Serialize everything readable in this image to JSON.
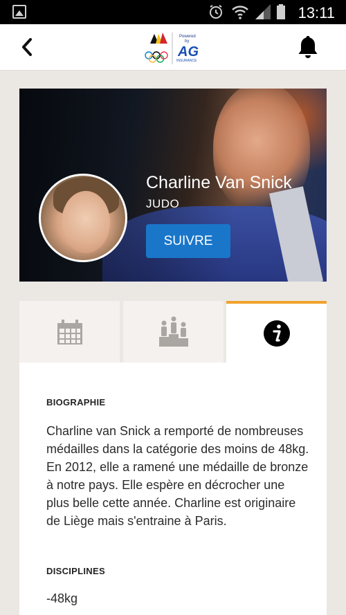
{
  "status_bar": {
    "time": "13:11",
    "icons": [
      "gallery-icon",
      "alarm-icon",
      "wifi-icon",
      "signal-icon",
      "battery-icon"
    ]
  },
  "header": {
    "back_icon": "chevron-left-icon",
    "logo_text": "Powered by AG INSURANCE",
    "notification_icon": "bell-icon"
  },
  "athlete": {
    "name": "Charline Van Snick",
    "sport": "JUDO",
    "follow_label": "SUIVRE"
  },
  "tabs": [
    {
      "icon": "calendar-icon",
      "active": false
    },
    {
      "icon": "podium-icon",
      "active": false
    },
    {
      "icon": "info-icon",
      "active": true
    }
  ],
  "content": {
    "bio_title": "BIOGRAPHIE",
    "bio_text": "Charline van Snick a remporté de nombreuses médailles dans la catégorie des moins de 48kg. En 2012, elle a ramené une médaille de bronze à notre pays. Elle espère en décrocher une plus belle cette année. Charline est originaire de Liège mais s'entraine à Paris.",
    "disciplines_title": "DISCIPLINES",
    "discipline": "-48kg"
  },
  "colors": {
    "accent": "#f1a22b",
    "button": "#1a76c9",
    "background": "#ebe8e4"
  }
}
